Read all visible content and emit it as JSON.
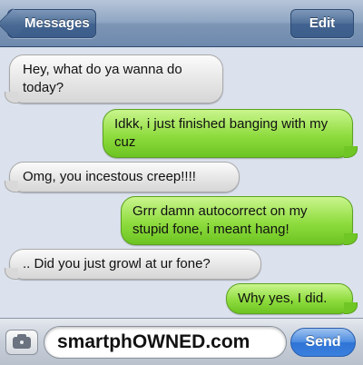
{
  "navbar": {
    "back_label": "Messages",
    "edit_label": "Edit"
  },
  "messages": [
    {
      "direction": "incoming",
      "text": "Hey, what do ya wanna do today?"
    },
    {
      "direction": "outgoing",
      "text": "Idkk, i just finished banging with my cuz"
    },
    {
      "direction": "incoming",
      "text": "Omg, you incestous creep!!!!"
    },
    {
      "direction": "outgoing",
      "text": "Grrr damn autocorrect on my stupid fone, i meant hang!"
    },
    {
      "direction": "incoming",
      "text": ".. Did you just growl at ur fone?"
    },
    {
      "direction": "outgoing",
      "text": "Why yes, I did."
    }
  ],
  "input": {
    "camera_icon": "camera-icon",
    "field_value": "smartphOWNED.com",
    "send_label": "Send"
  },
  "colors": {
    "incoming_bubble": "#e4e4e4",
    "outgoing_bubble": "#8fdc3f",
    "navbar": "#7d96b6",
    "send_button": "#3a80de"
  }
}
